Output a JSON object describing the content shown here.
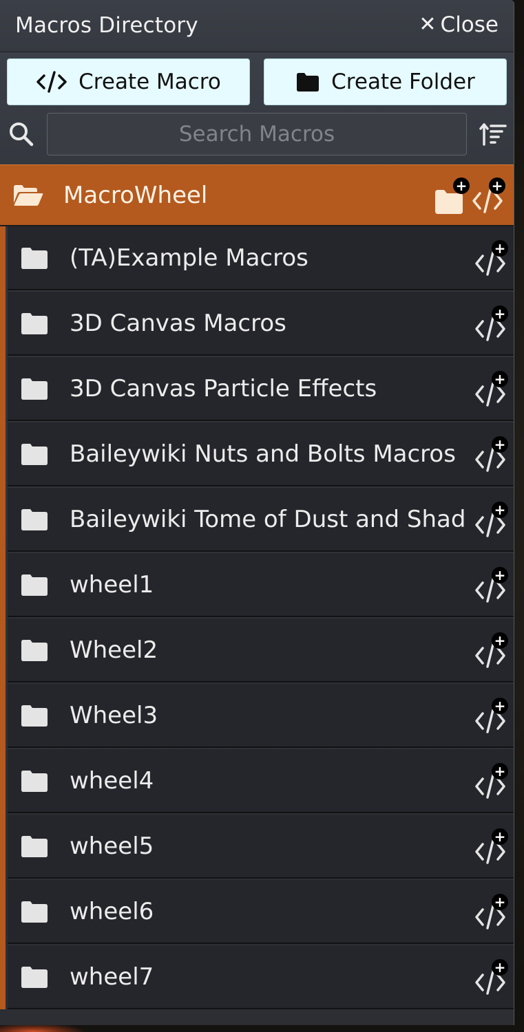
{
  "header": {
    "title": "Macros Directory",
    "close_label": "Close"
  },
  "actions": {
    "create_macro_label": "Create Macro",
    "create_folder_label": "Create Folder"
  },
  "search": {
    "placeholder": "Search Macros",
    "value": ""
  },
  "open_folder": {
    "label": "MacroWheel"
  },
  "folders": [
    {
      "label": "(TA)Example Macros"
    },
    {
      "label": "3D Canvas Macros"
    },
    {
      "label": "3D Canvas Particle Effects"
    },
    {
      "label": "Baileywiki Nuts and Bolts Macros"
    },
    {
      "label": "Baileywiki Tome of Dust and Shad"
    },
    {
      "label": "wheel1"
    },
    {
      "label": "Wheel2"
    },
    {
      "label": "Wheel3"
    },
    {
      "label": "wheel4"
    },
    {
      "label": "wheel5"
    },
    {
      "label": "wheel6"
    },
    {
      "label": "wheel7"
    }
  ],
  "colors": {
    "accent": "#b45a1f",
    "button_bg": "#e6fbff",
    "row_bg": "#25262b"
  },
  "icons": {
    "search": "search-icon",
    "sort": "sort-icon",
    "folder": "folder-icon",
    "folder_open": "folder-open-icon",
    "create_macro": "code-icon",
    "create_folder": "folder-icon",
    "add_macro": "add-macro-icon",
    "add_folder": "add-folder-icon",
    "close": "close-icon"
  }
}
